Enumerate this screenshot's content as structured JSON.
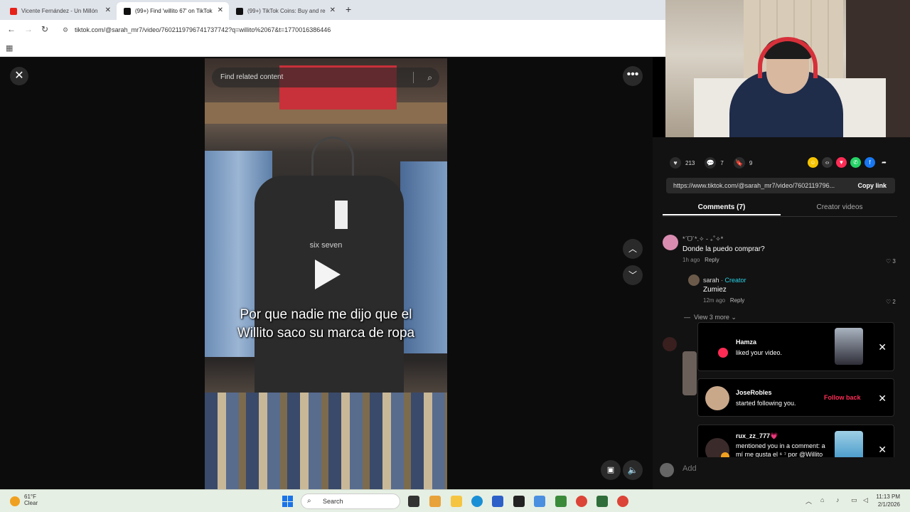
{
  "browser": {
    "tabs": [
      {
        "title": "Vicente Fernández - Un Millón",
        "icon_color": "#e62117"
      },
      {
        "title": "(99+) Find 'willito 67' on TikTok",
        "icon_color": "#111111"
      },
      {
        "title": "(99+) TikTok Coins: Buy and rec",
        "icon_color": "#111111"
      }
    ],
    "url": "tiktok.com/@sarah_mr7/video/7602119796741737742?q=willito%2067&t=1770016386446"
  },
  "video": {
    "search_placeholder": "Find related content",
    "shirt_text": "six seven",
    "caption": "Por que nadie me dijo que el Willito saco su marca de ropa"
  },
  "stats": {
    "likes": "213",
    "comments": "7",
    "saves": "9"
  },
  "share_link": {
    "url": "https://www.tiktok.com/@sarah_mr7/video/7602119796...",
    "copy_label": "Copy link"
  },
  "tabs": {
    "comments": "Comments (7)",
    "creator_videos": "Creator videos"
  },
  "comments": [
    {
      "user": "*ˊᗜˋ*.✧ - ₊˚✧*",
      "text": "Donde la puedo comprar?",
      "time": "1h ago",
      "reply": "Reply",
      "likes": "3"
    },
    {
      "user": "sarah",
      "badge": "Creator",
      "text": "Zumiez",
      "time": "12m ago",
      "reply": "Reply",
      "likes": "2"
    }
  ],
  "view_more": "View 3 more",
  "notifications": [
    {
      "name": "Hamza",
      "text": "liked your video."
    },
    {
      "name": "JoseRobles",
      "text": "started following you.",
      "action": "Follow back"
    },
    {
      "name": "rux_zz_777💗",
      "text": "mentioned you in a comment: a mí me gusta el ⁶ ⁷ por @Willito"
    }
  ],
  "add_comment_placeholder": "Add",
  "taskbar": {
    "weather_temp": "61°F",
    "weather_desc": "Clear",
    "search": "Search",
    "time": "11:13 PM",
    "date": "2/1/2026"
  },
  "colors": {
    "accent": "#fe2c55",
    "creator": "#2ad2e6"
  }
}
